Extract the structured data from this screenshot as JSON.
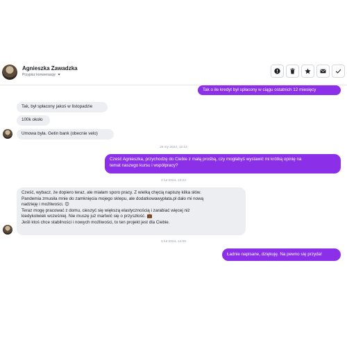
{
  "header": {
    "contact_name": "Agnieszka Zawadzka",
    "assign_label": "Przypisz konwersację",
    "assign_caret": "⏷",
    "actions": [
      {
        "name": "info-icon"
      },
      {
        "name": "trash-icon"
      },
      {
        "name": "star-icon"
      },
      {
        "name": "mail-icon"
      },
      {
        "name": "check-icon"
      }
    ]
  },
  "messages": {
    "m1": "Tak o ile kredyt był spłacony w ciągu ostatnich 12 miesięcy",
    "m2": "Tak, był spłacony jakoś w listopadzie",
    "m3": "100k około",
    "m4": "Umowa była. Getin bank (obecnie velo)",
    "ts1": "26 sty 2024, 12:13",
    "m5_line1": "Cześć Agnieszka, przychodzę do Ciebie z małą prośbą, czy mogłabyś wystawić mi krótką opinię na",
    "m5_line2": "temat naszego kursu i współpracy?",
    "ts2": "2 lut 2024, 13:23",
    "m6_line1": "Cześć, wybacz, że dopiero teraz, ale miałam sporo pracy. Z wielką chęcią napiszę kilka słów.",
    "m6_line2": "Pandemia zmusiła mnie do zamknięcia mojego sklepu, ale dodatkowawypłata.pl dało mi nową",
    "m6_line3": "nadzieję i możliwości. 😊",
    "m6_line4": "Teraz mogę pracować z domu, cieszyć się większą elastycznością i zarabiać więcej niż",
    "m6_line5": "kiedykolwiek wcześniej. Nie muszę już martwić się o przyszłość. 💼",
    "m6_line6": "Jeśli ktoś chce stabilności i nowych możliwości, to ten projekt jest dla Ciebie.",
    "ts3": "5 lut 2024, 14:09",
    "m7": "Ładnie napisane, dziękuję. Na pewno się przyda!"
  },
  "colors": {
    "outgoing": "#8b30e8",
    "incoming": "#eceef1"
  }
}
